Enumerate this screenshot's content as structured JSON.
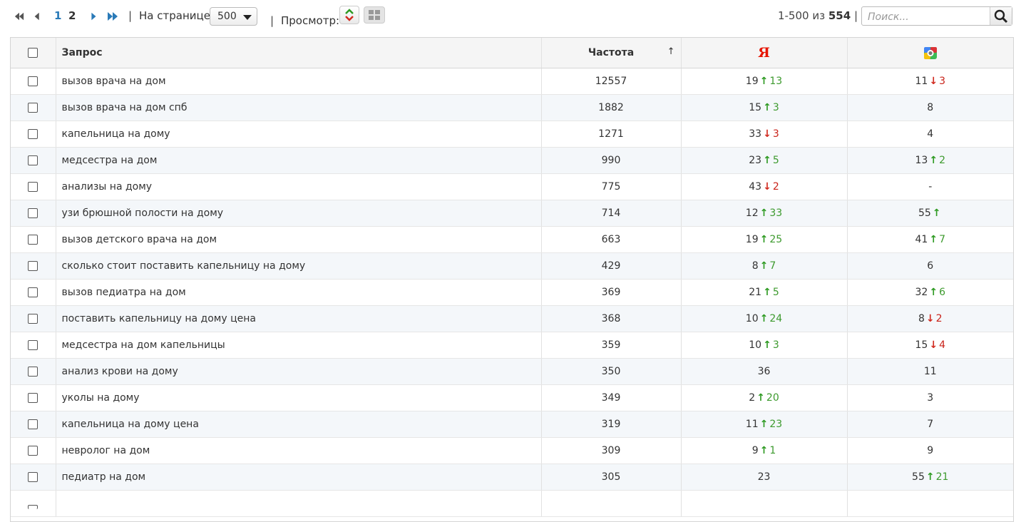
{
  "pager": {
    "pages": [
      "1",
      "2"
    ],
    "per_page_label": "На странице:",
    "per_page_value": "500",
    "view_label": "Просмотр:",
    "separator": "|"
  },
  "summary": {
    "range": "1-500 из",
    "total": "554",
    "trailing": "|"
  },
  "search": {
    "placeholder": "Поиск..."
  },
  "icons": {
    "first": "double-left-arrow",
    "prev": "left-arrow",
    "next": "right-arrow",
    "last": "double-right-arrow",
    "view_positions": "up-down-arrows",
    "view_grid": "grid",
    "search": "magnifier",
    "yandex": "yandex-logo",
    "google": "google-logo"
  },
  "colors": {
    "accent": "#2a7ab8",
    "up": "#2e9a22",
    "down": "#d12a1f",
    "yandex": "#e61400"
  },
  "table": {
    "headers": {
      "query": "Запрос",
      "freq": "Частота",
      "sort": "↑",
      "yandex": "Я"
    },
    "rows": [
      {
        "q": "вызов врача на дом",
        "f": "12557",
        "y": {
          "p": "19",
          "dir": "up",
          "d": "13"
        },
        "g": {
          "p": "11",
          "dir": "down",
          "d": "3"
        }
      },
      {
        "q": "вызов врача на дом спб",
        "f": "1882",
        "y": {
          "p": "15",
          "dir": "up",
          "d": "3"
        },
        "g": {
          "p": "8",
          "dir": "",
          "d": ""
        }
      },
      {
        "q": "капельница на дому",
        "f": "1271",
        "y": {
          "p": "33",
          "dir": "down",
          "d": "3"
        },
        "g": {
          "p": "4",
          "dir": "",
          "d": ""
        }
      },
      {
        "q": "медсестра на дом",
        "f": "990",
        "y": {
          "p": "23",
          "dir": "up",
          "d": "5"
        },
        "g": {
          "p": "13",
          "dir": "up",
          "d": "2"
        }
      },
      {
        "q": "анализы на дому",
        "f": "775",
        "y": {
          "p": "43",
          "dir": "down",
          "d": "2"
        },
        "g": {
          "p": "-",
          "dir": "",
          "d": ""
        }
      },
      {
        "q": "узи брюшной полости на дому",
        "f": "714",
        "y": {
          "p": "12",
          "dir": "up",
          "d": "33"
        },
        "g": {
          "p": "55",
          "dir": "up",
          "d": ""
        }
      },
      {
        "q": "вызов детского врача на дом",
        "f": "663",
        "y": {
          "p": "19",
          "dir": "up",
          "d": "25"
        },
        "g": {
          "p": "41",
          "dir": "up",
          "d": "7"
        }
      },
      {
        "q": "сколько стоит поставить капельницу на дому",
        "f": "429",
        "y": {
          "p": "8",
          "dir": "up",
          "d": "7"
        },
        "g": {
          "p": "6",
          "dir": "",
          "d": ""
        }
      },
      {
        "q": "вызов педиатра на дом",
        "f": "369",
        "y": {
          "p": "21",
          "dir": "up",
          "d": "5"
        },
        "g": {
          "p": "32",
          "dir": "up",
          "d": "6"
        }
      },
      {
        "q": "поставить капельницу на дому цена",
        "f": "368",
        "y": {
          "p": "10",
          "dir": "up",
          "d": "24"
        },
        "g": {
          "p": "8",
          "dir": "down",
          "d": "2"
        }
      },
      {
        "q": "медсестра на дом капельницы",
        "f": "359",
        "y": {
          "p": "10",
          "dir": "up",
          "d": "3"
        },
        "g": {
          "p": "15",
          "dir": "down",
          "d": "4"
        }
      },
      {
        "q": "анализ крови на дому",
        "f": "350",
        "y": {
          "p": "36",
          "dir": "",
          "d": ""
        },
        "g": {
          "p": "11",
          "dir": "",
          "d": ""
        }
      },
      {
        "q": "уколы на дому",
        "f": "349",
        "y": {
          "p": "2",
          "dir": "up",
          "d": "20"
        },
        "g": {
          "p": "3",
          "dir": "",
          "d": ""
        }
      },
      {
        "q": "капельница на дому цена",
        "f": "319",
        "y": {
          "p": "11",
          "dir": "up",
          "d": "23"
        },
        "g": {
          "p": "7",
          "dir": "",
          "d": ""
        }
      },
      {
        "q": "невролог на дом",
        "f": "309",
        "y": {
          "p": "9",
          "dir": "up",
          "d": "1"
        },
        "g": {
          "p": "9",
          "dir": "",
          "d": ""
        }
      },
      {
        "q": "педиатр на дом",
        "f": "305",
        "y": {
          "p": "23",
          "dir": "",
          "d": ""
        },
        "g": {
          "p": "55",
          "dir": "up",
          "d": "21"
        }
      },
      {
        "q": "",
        "f": "",
        "y": {
          "p": "",
          "dir": "",
          "d": ""
        },
        "g": {
          "p": "",
          "dir": "",
          "d": ""
        }
      }
    ]
  }
}
